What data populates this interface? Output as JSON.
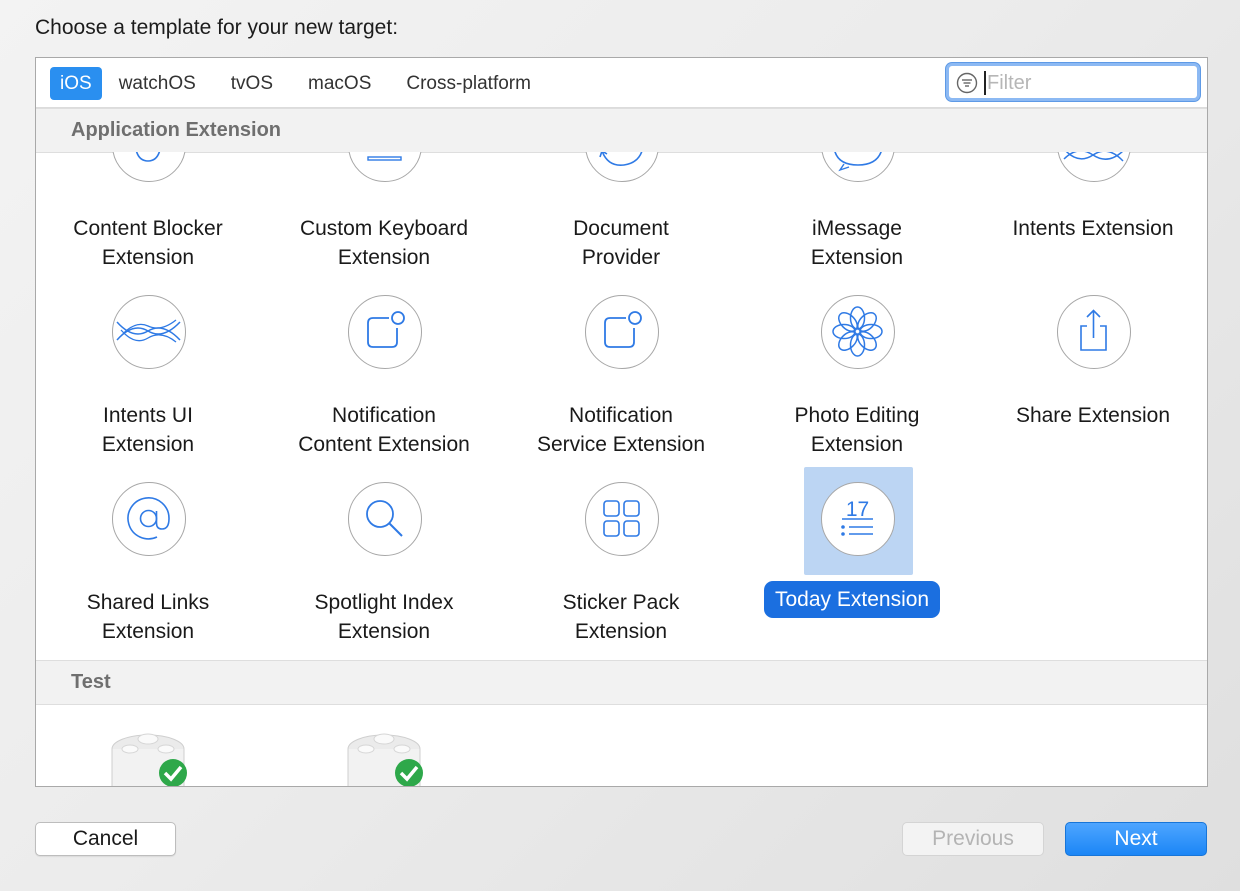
{
  "heading": "Choose a template for your new target:",
  "tabs": [
    "iOS",
    "watchOS",
    "tvOS",
    "macOS",
    "Cross-platform"
  ],
  "active_tab": "iOS",
  "filter": {
    "placeholder": "Filter",
    "value": ""
  },
  "sections": {
    "application_extension": {
      "title": "Application Extension",
      "items": [
        {
          "label": "Content Blocker\nExtension",
          "icon": "content-blocker-icon"
        },
        {
          "label": "Custom Keyboard\nExtension",
          "icon": "keyboard-icon"
        },
        {
          "label": "Document\nProvider",
          "icon": "document-provider-icon"
        },
        {
          "label": "iMessage\nExtension",
          "icon": "message-bubble-icon"
        },
        {
          "label": "Intents Extension",
          "icon": "intents-waves-icon"
        },
        {
          "label": "Intents UI\nExtension",
          "icon": "intents-waves-icon"
        },
        {
          "label": "Notification\nContent Extension",
          "icon": "notification-icon"
        },
        {
          "label": "Notification\nService Extension",
          "icon": "notification-icon"
        },
        {
          "label": "Photo Editing\nExtension",
          "icon": "photo-flower-icon"
        },
        {
          "label": "Share Extension",
          "icon": "share-icon"
        },
        {
          "label": "Shared Links\nExtension",
          "icon": "at-sign-icon"
        },
        {
          "label": "Spotlight Index\nExtension",
          "icon": "magnifier-icon"
        },
        {
          "label": "Sticker Pack\nExtension",
          "icon": "sticker-grid-icon"
        },
        {
          "label": "Today Extension",
          "icon": "today-calendar-icon",
          "selected": true,
          "icon_text": "17"
        }
      ]
    },
    "test": {
      "title": "Test"
    }
  },
  "buttons": {
    "cancel": "Cancel",
    "previous": "Previous",
    "next": "Next"
  },
  "colors": {
    "accent": "#1b6fe0",
    "selection_bg": "#bcd5f3",
    "icon_stroke": "#2f7ae5"
  }
}
